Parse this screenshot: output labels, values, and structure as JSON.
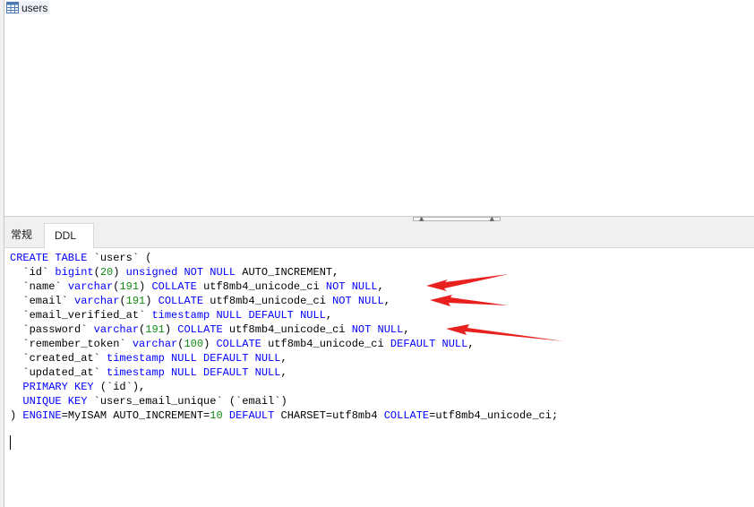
{
  "object_list": {
    "items": [
      {
        "name": "users",
        "icon": "table-icon"
      }
    ]
  },
  "tabs": [
    {
      "label": "常规",
      "active": false
    },
    {
      "label": "DDL",
      "active": true
    }
  ],
  "ddl": {
    "lines": [
      [
        {
          "t": "CREATE TABLE",
          "c": "kw"
        },
        {
          "t": " `users` (",
          "c": ""
        }
      ],
      [
        {
          "t": "  `id` ",
          "c": ""
        },
        {
          "t": "bigint",
          "c": "kw"
        },
        {
          "t": "(",
          "c": ""
        },
        {
          "t": "20",
          "c": "num"
        },
        {
          "t": ") ",
          "c": ""
        },
        {
          "t": "unsigned NOT NULL",
          "c": "kw"
        },
        {
          "t": " AUTO_INCREMENT,",
          "c": ""
        }
      ],
      [
        {
          "t": "  `name` ",
          "c": ""
        },
        {
          "t": "varchar",
          "c": "kw"
        },
        {
          "t": "(",
          "c": ""
        },
        {
          "t": "191",
          "c": "num"
        },
        {
          "t": ") ",
          "c": ""
        },
        {
          "t": "COLLATE",
          "c": "kw"
        },
        {
          "t": " utf8mb4_unicode_ci ",
          "c": ""
        },
        {
          "t": "NOT NULL",
          "c": "kw"
        },
        {
          "t": ",",
          "c": ""
        }
      ],
      [
        {
          "t": "  `email` ",
          "c": ""
        },
        {
          "t": "varchar",
          "c": "kw"
        },
        {
          "t": "(",
          "c": ""
        },
        {
          "t": "191",
          "c": "num"
        },
        {
          "t": ") ",
          "c": ""
        },
        {
          "t": "COLLATE",
          "c": "kw"
        },
        {
          "t": " utf8mb4_unicode_ci ",
          "c": ""
        },
        {
          "t": "NOT NULL",
          "c": "kw"
        },
        {
          "t": ",",
          "c": ""
        }
      ],
      [
        {
          "t": "  `email_verified_at` ",
          "c": ""
        },
        {
          "t": "timestamp NULL DEFAULT NULL",
          "c": "kw"
        },
        {
          "t": ",",
          "c": ""
        }
      ],
      [
        {
          "t": "  `password` ",
          "c": ""
        },
        {
          "t": "varchar",
          "c": "kw"
        },
        {
          "t": "(",
          "c": ""
        },
        {
          "t": "191",
          "c": "num"
        },
        {
          "t": ") ",
          "c": ""
        },
        {
          "t": "COLLATE",
          "c": "kw"
        },
        {
          "t": " utf8mb4_unicode_ci ",
          "c": ""
        },
        {
          "t": "NOT NULL",
          "c": "kw"
        },
        {
          "t": ",",
          "c": ""
        }
      ],
      [
        {
          "t": "  `remember_token` ",
          "c": ""
        },
        {
          "t": "varchar",
          "c": "kw"
        },
        {
          "t": "(",
          "c": ""
        },
        {
          "t": "100",
          "c": "num"
        },
        {
          "t": ") ",
          "c": ""
        },
        {
          "t": "COLLATE",
          "c": "kw"
        },
        {
          "t": " utf8mb4_unicode_ci ",
          "c": ""
        },
        {
          "t": "DEFAULT NULL",
          "c": "kw"
        },
        {
          "t": ",",
          "c": ""
        }
      ],
      [
        {
          "t": "  `created_at` ",
          "c": ""
        },
        {
          "t": "timestamp NULL DEFAULT NULL",
          "c": "kw"
        },
        {
          "t": ",",
          "c": ""
        }
      ],
      [
        {
          "t": "  `updated_at` ",
          "c": ""
        },
        {
          "t": "timestamp NULL DEFAULT NULL",
          "c": "kw"
        },
        {
          "t": ",",
          "c": ""
        }
      ],
      [
        {
          "t": "  PRIMARY KEY",
          "c": "kw"
        },
        {
          "t": " (`id`),",
          "c": ""
        }
      ],
      [
        {
          "t": "  UNIQUE KEY",
          "c": "kw"
        },
        {
          "t": " `users_email_unique` (`email`)",
          "c": ""
        }
      ],
      [
        {
          "t": ") ",
          "c": ""
        },
        {
          "t": "ENGINE",
          "c": "kw"
        },
        {
          "t": "=MyISAM AUTO_INCREMENT=",
          "c": ""
        },
        {
          "t": "10",
          "c": "num"
        },
        {
          "t": " ",
          "c": ""
        },
        {
          "t": "DEFAULT",
          "c": "kw"
        },
        {
          "t": " CHARSET=utf8mb4 ",
          "c": ""
        },
        {
          "t": "COLLATE",
          "c": "kw"
        },
        {
          "t": "=utf8mb4_unicode_ci;",
          "c": ""
        }
      ]
    ]
  },
  "colors": {
    "keyword": "#0000ff",
    "number": "#0f8b0f",
    "plain": "#000000",
    "annotation_arrow": "#e8201e"
  }
}
